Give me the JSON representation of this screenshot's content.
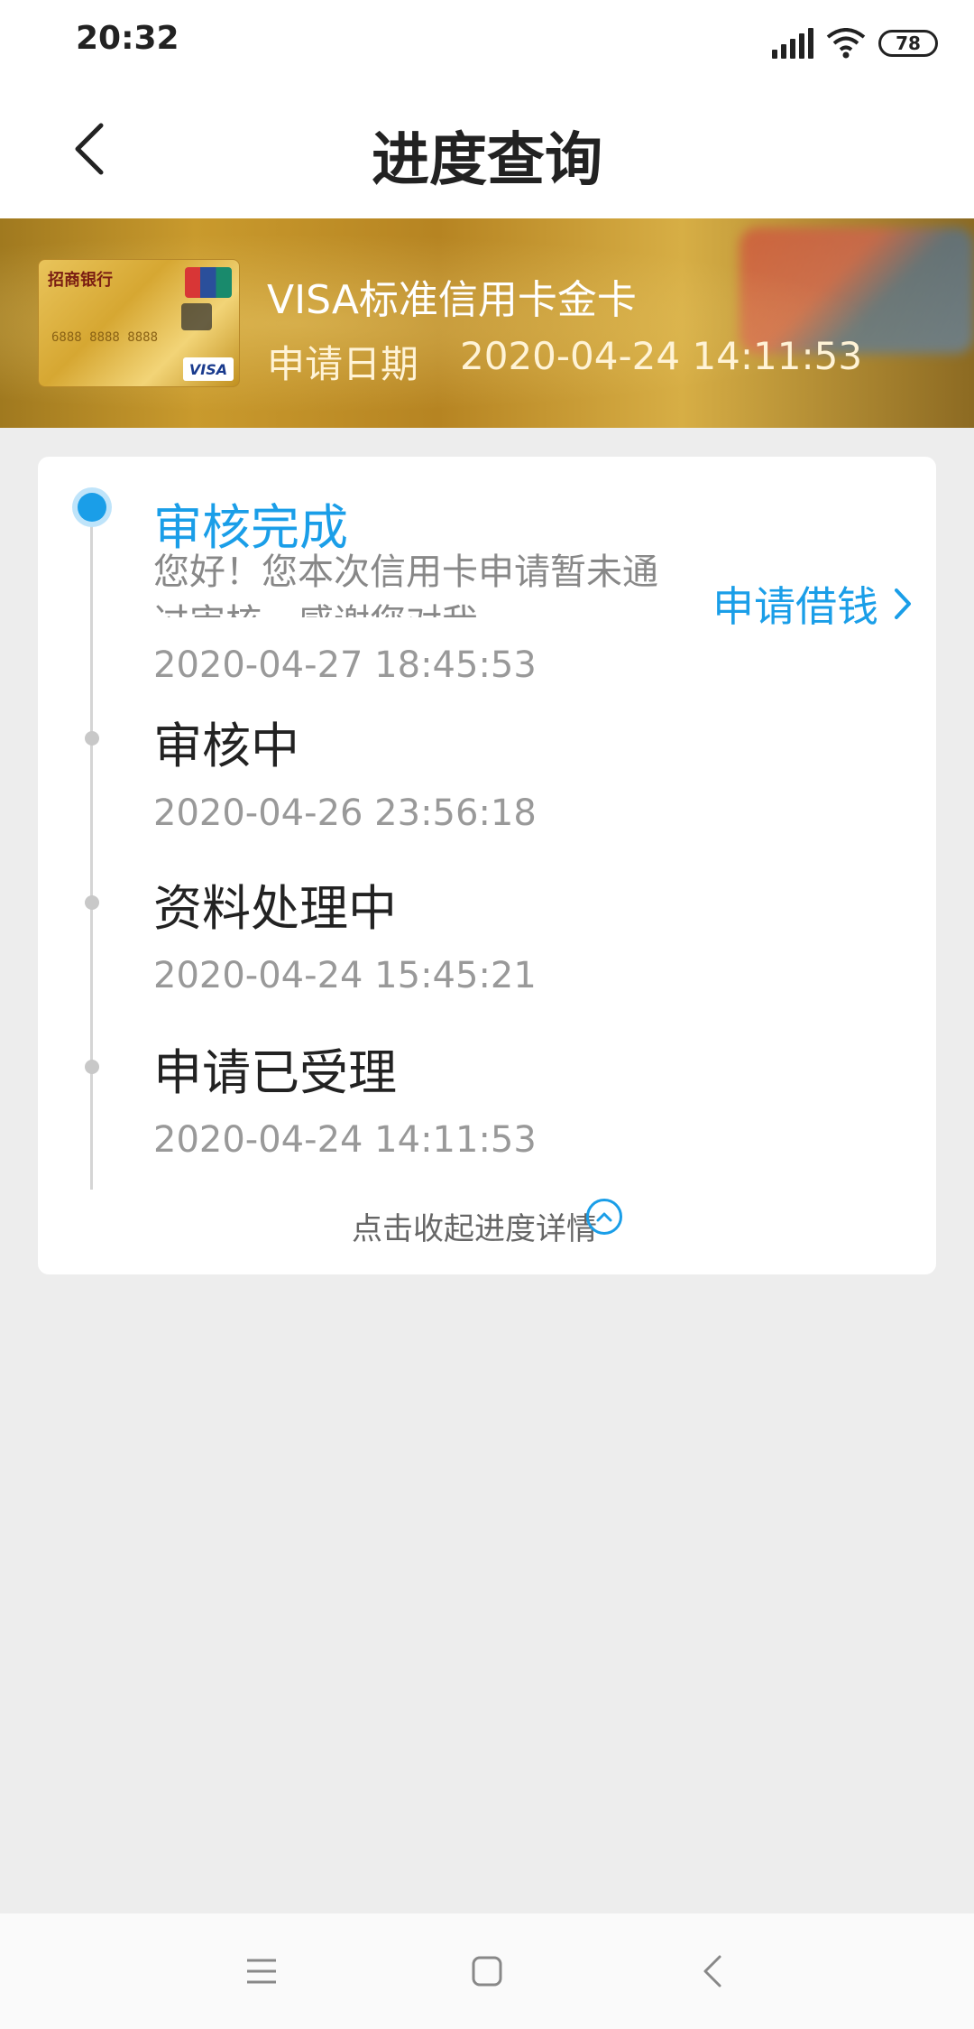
{
  "status_bar": {
    "time": "20:32",
    "battery": "78",
    "icons": [
      "signal-icon",
      "wifi-icon",
      "battery-icon"
    ]
  },
  "header": {
    "title": "进度查询",
    "back_icon": "chevron-left-icon"
  },
  "banner": {
    "card_name": "VISA标准信用卡金卡",
    "date_label": "申请日期",
    "date_value": "2020-04-24 14:11:53",
    "card_image": {
      "bank_name": "招商银行",
      "number": "6888 8888 8888",
      "brand": "VISA"
    }
  },
  "progress": {
    "steps": [
      {
        "title": "审核完成",
        "description": "您好！您本次信用卡申请暂未通过审核，感谢您对我",
        "time": "2020-04-27 18:45:53",
        "active": true
      },
      {
        "title": "审核中",
        "time": "2020-04-26 23:56:18",
        "active": false
      },
      {
        "title": "资料处理中",
        "time": "2020-04-24 15:45:21",
        "active": false
      },
      {
        "title": "申请已受理",
        "time": "2020-04-24 14:11:53",
        "active": false
      }
    ],
    "borrow_link": "申请借钱",
    "collapse_label": "点击收起进度详情"
  },
  "nav_bar": {
    "items": [
      "menu-icon",
      "home-icon",
      "back-icon"
    ]
  },
  "colors": {
    "accent": "#1a9ee8",
    "background": "#ededed"
  }
}
